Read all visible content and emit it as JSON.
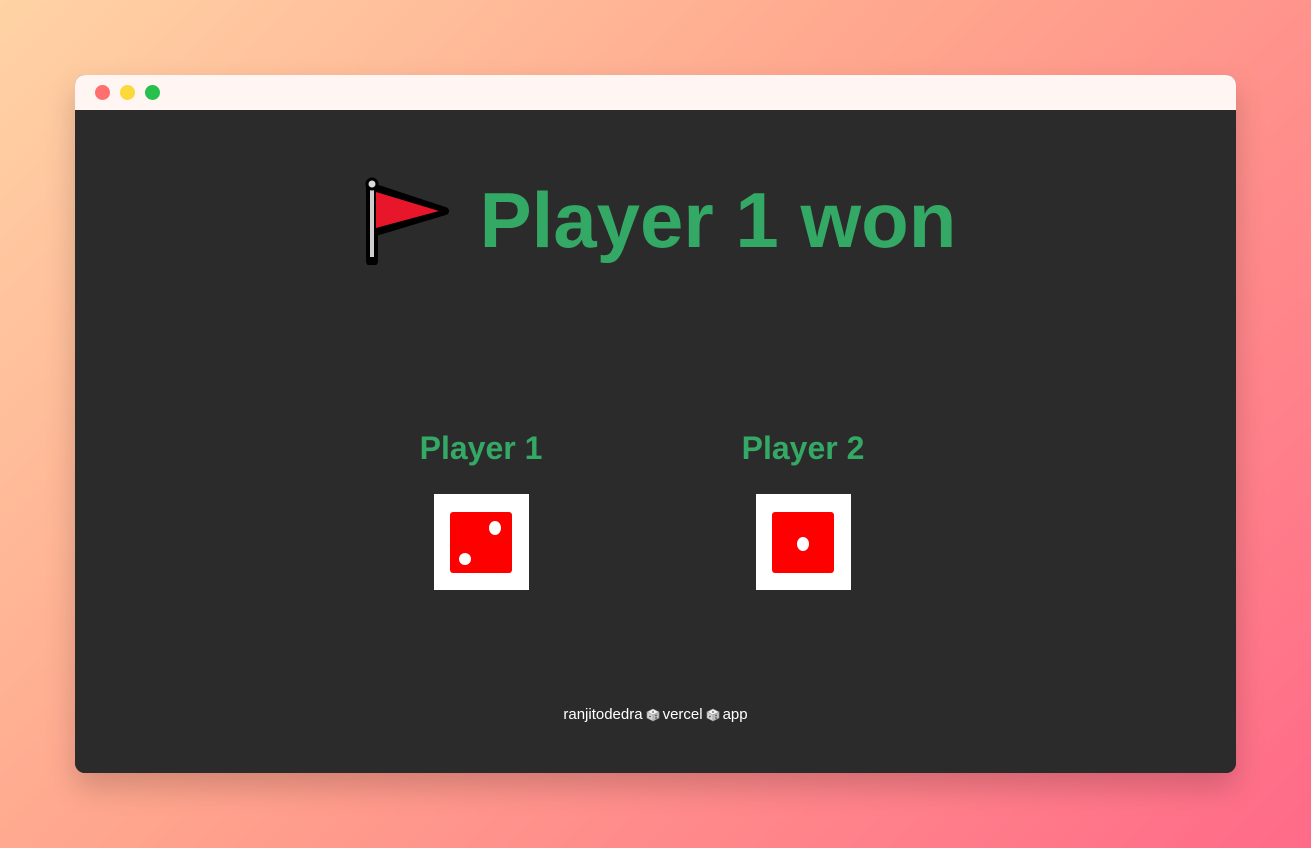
{
  "window": {
    "controls": {
      "close_color": "#ff6f6f",
      "minimize_color": "#fcd93a",
      "maximize_color": "#27c04d"
    }
  },
  "game": {
    "result_text": "Player 1 won",
    "result_icon": "red-flag-icon",
    "accent_color": "#34a865",
    "players": [
      {
        "name": "Player 1",
        "die_face": 2,
        "die_color": "#ff0000"
      },
      {
        "name": "Player 2",
        "die_face": 1,
        "die_color": "#ff0000"
      }
    ]
  },
  "footer": {
    "parts": [
      "ranjitodedra",
      "vercel",
      "app"
    ],
    "separator_icon": "dice-cube-icon"
  }
}
